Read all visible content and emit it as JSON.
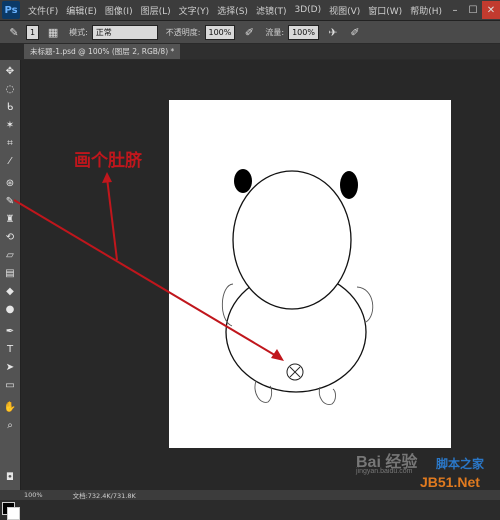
{
  "app": {
    "logo": "Ps",
    "menu": [
      "文件(F)",
      "编辑(E)",
      "图像(I)",
      "图层(L)",
      "文字(Y)",
      "选择(S)",
      "滤镜(T)",
      "3D(D)",
      "视图(V)",
      "窗口(W)",
      "帮助(H)"
    ],
    "window_buttons": [
      "–",
      "☐",
      "✕"
    ]
  },
  "options": {
    "brush_size": "1",
    "mode_label": "模式:",
    "mode_value": "正常",
    "opacity_label": "不透明度:",
    "opacity_value": "100%",
    "flow_label": "流量:",
    "flow_value": "100%"
  },
  "document": {
    "tab_title": "未标题-1.psd @ 100% (图层 2, RGB/8) *",
    "canvas_bg": "#ffffff"
  },
  "annotation": {
    "text": "画个肚脐",
    "color": "#c0161c"
  },
  "status": {
    "zoom": "100%",
    "doc_info": "文档:732.4K/731.8K"
  },
  "watermark": {
    "brand": "Bai 经验",
    "site": "jingyan.baidu.com",
    "site2": "JB51.Net",
    "site_label": "脚本之家"
  }
}
